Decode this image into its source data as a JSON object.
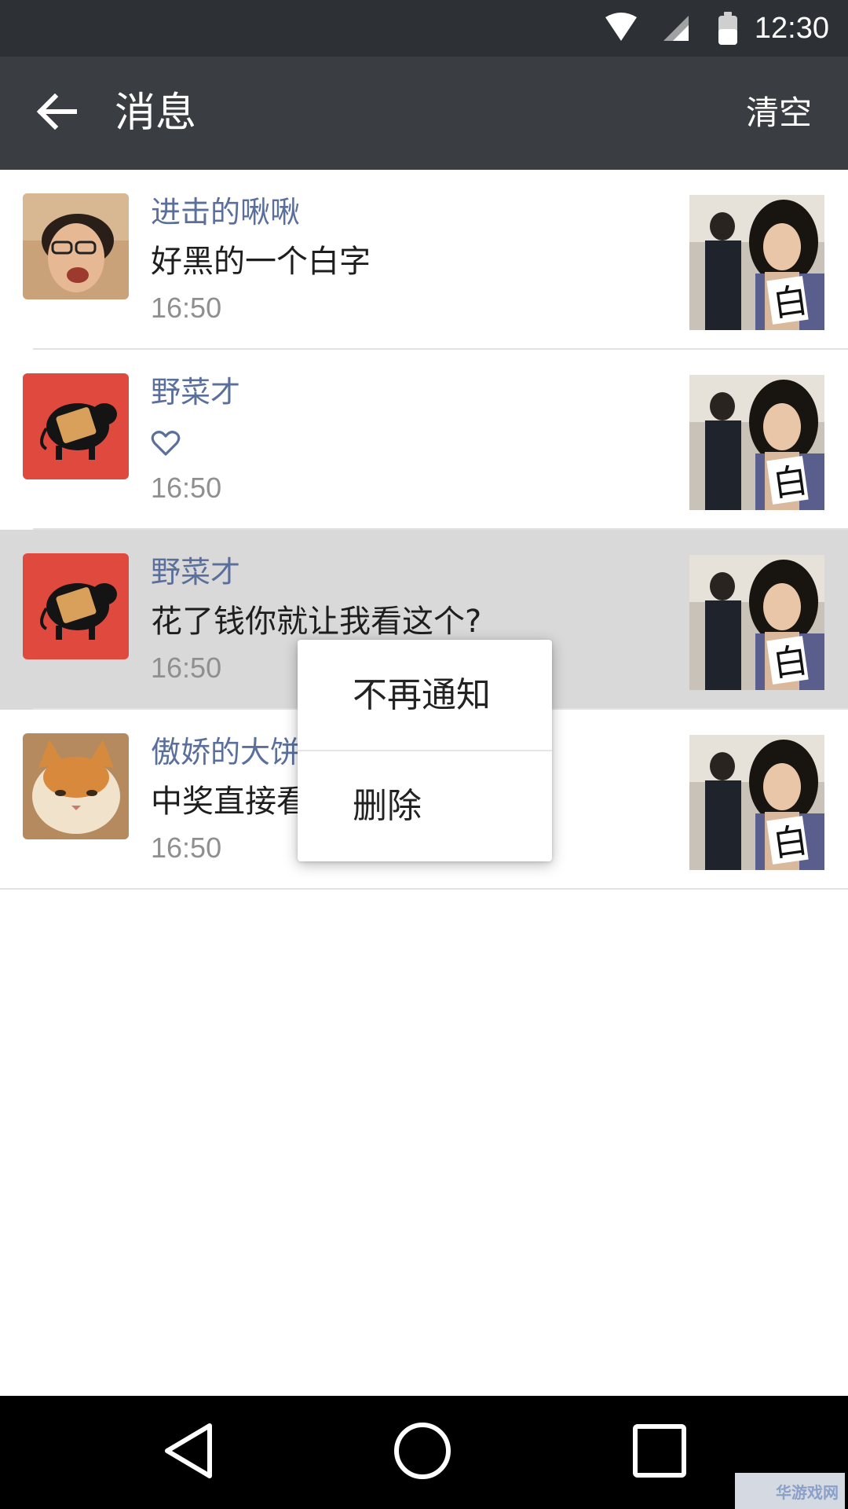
{
  "status_bar": {
    "time": "12:30",
    "icons": [
      "wifi-icon",
      "cell-signal-icon",
      "battery-icon"
    ]
  },
  "app_bar": {
    "back_icon": "arrow-left-icon",
    "title": "消息",
    "clear_label": "清空"
  },
  "messages": [
    {
      "name": "进击的啾啾",
      "text": "好黑的一个白字",
      "time": "16:50",
      "avatar": "man-glasses-avatar",
      "thumb": "couple-photo-thumbnail"
    },
    {
      "name": "野菜才",
      "text": "",
      "icon": "heart-outline-icon",
      "time": "16:50",
      "avatar": "black-pig-avatar",
      "thumb": "couple-photo-thumbnail"
    },
    {
      "name": "野菜才",
      "text": "花了钱你就让我看这个?",
      "time": "16:50",
      "avatar": "black-pig-avatar",
      "thumb": "couple-photo-thumbnail",
      "selected": true
    },
    {
      "name": "傲娇的大饼",
      "text": "中奖直接看",
      "time": "16:50",
      "avatar": "cat-avatar",
      "thumb": "couple-photo-thumbnail"
    }
  ],
  "context_menu": {
    "items": [
      "不再通知",
      "删除"
    ]
  },
  "nav_bar": {
    "icons": [
      "nav-back-icon",
      "nav-home-icon",
      "nav-recents-icon"
    ]
  },
  "watermark": {
    "text": "华游戏网"
  },
  "colors": {
    "status_bar": "#2d3034",
    "app_bar": "#3a3d42",
    "name_text": "#5a6f9b",
    "time_text": "#8f8f8f",
    "selected_row": "#d9d9d9",
    "avatar_red": "#e0493e"
  }
}
